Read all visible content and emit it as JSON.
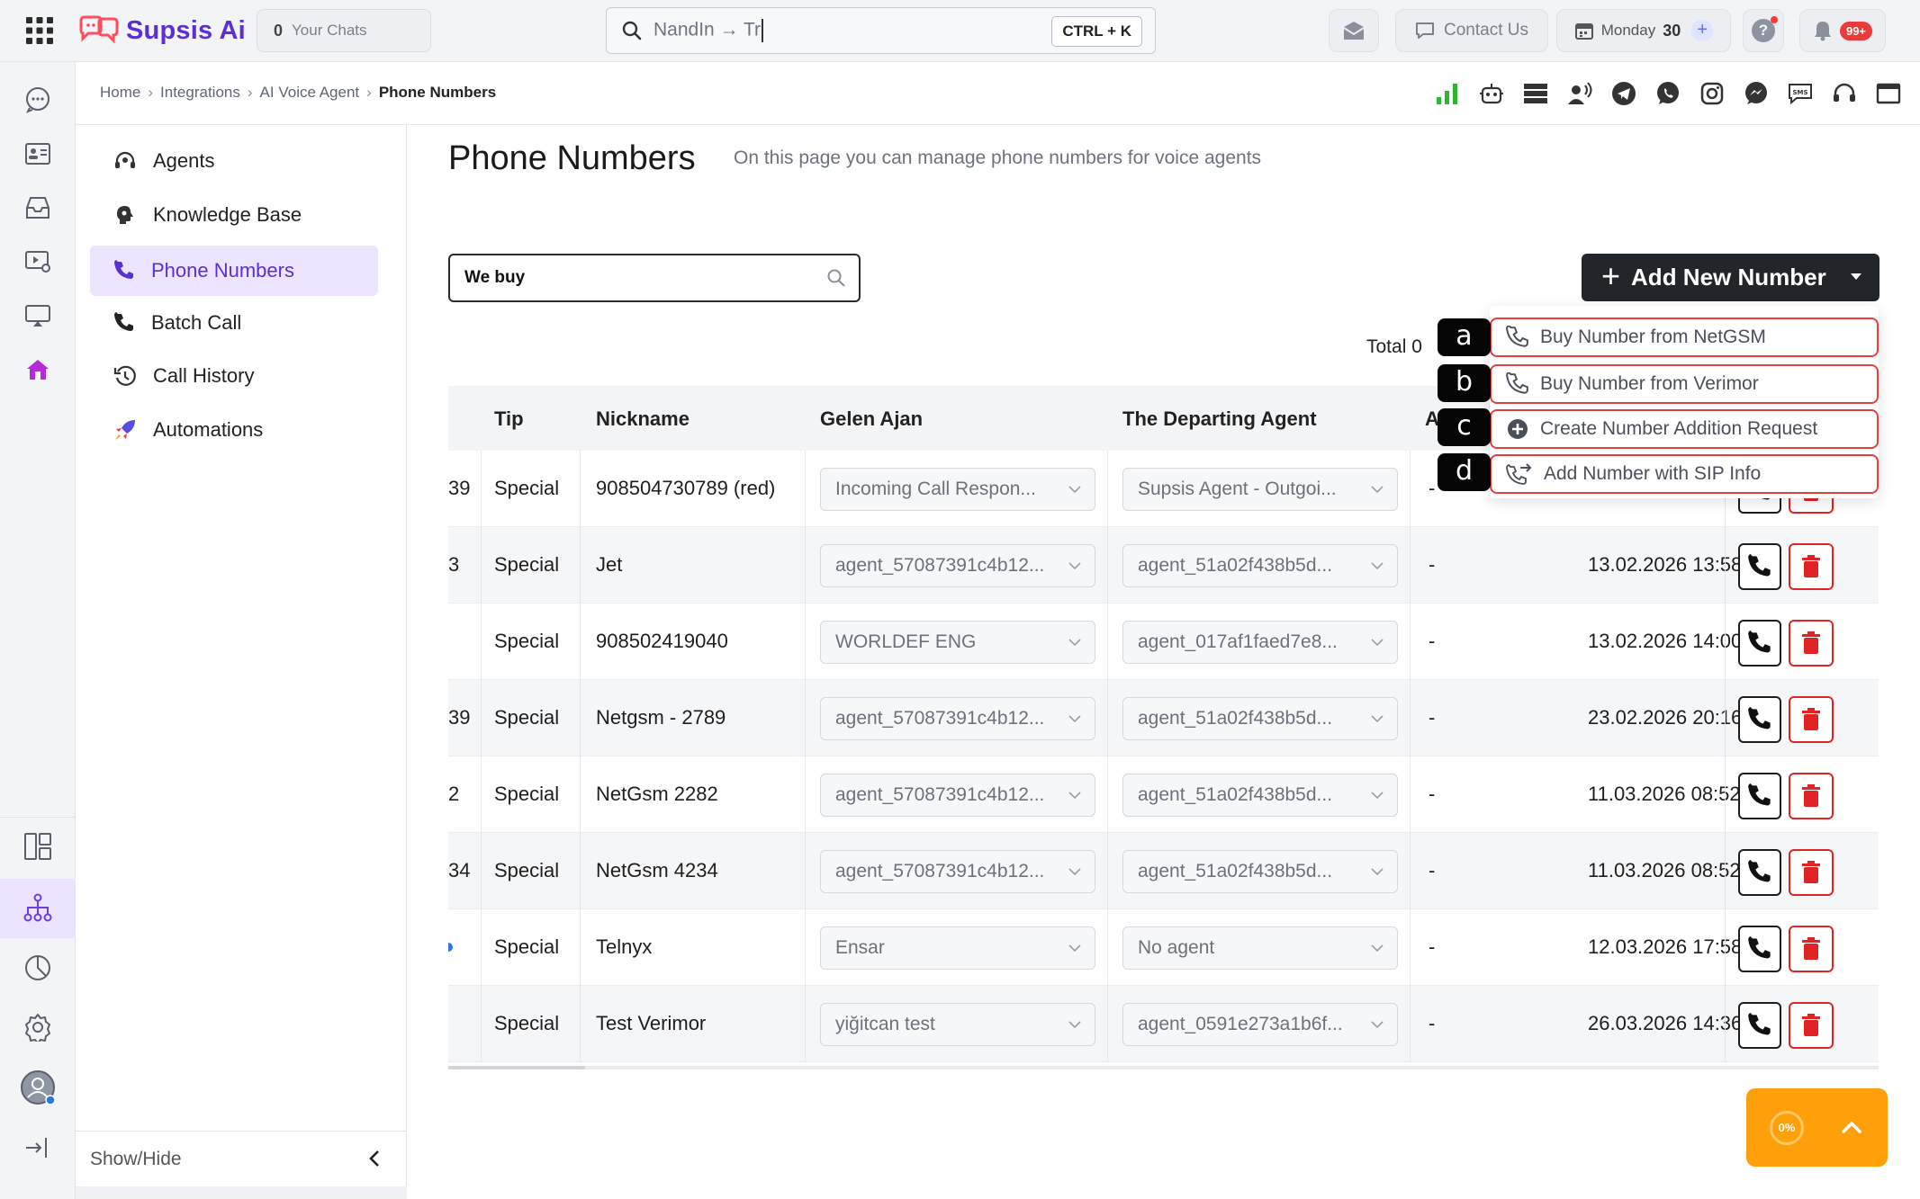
{
  "app": {
    "name": "Supsis Ai",
    "brand_color": "#5b2fd6"
  },
  "topbar": {
    "chats_count": "0",
    "chats_label": "Your Chats",
    "search_value": "NandIn → Tr",
    "search_shortcut": "CTRL + K",
    "contact_label": "Contact Us",
    "date_day": "Monday",
    "date_num": "30",
    "notif_badge": "99+"
  },
  "breadcrumb": {
    "items": [
      "Home",
      "Integrations",
      "AI Voice Agent"
    ],
    "current": "Phone Numbers"
  },
  "subnav": {
    "items": [
      {
        "label": "Agents",
        "icon": "headset-icon"
      },
      {
        "label": "Knowledge Base",
        "icon": "brain-icon"
      },
      {
        "label": "Phone Numbers",
        "icon": "phone-icon"
      },
      {
        "label": "Batch Call",
        "icon": "phone-icon"
      },
      {
        "label": "Call History",
        "icon": "history-icon"
      },
      {
        "label": "Automations",
        "icon": "rocket-icon"
      }
    ],
    "footer_label": "Show/Hide"
  },
  "page": {
    "title": "Phone Numbers",
    "subtitle": "On this page you can manage phone numbers for voice agents",
    "search_value": "We buy",
    "add_button": "Add New Number",
    "total_label": "Total 0"
  },
  "menu": {
    "items": [
      {
        "tag": "a",
        "label": "Buy Number from NetGSM",
        "icon": "phone-icon"
      },
      {
        "tag": "b",
        "label": "Buy Number from Verimor",
        "icon": "phone-icon"
      },
      {
        "tag": "c",
        "label": "Create Number Addition Request",
        "icon": "plus-circle-icon"
      },
      {
        "tag": "d",
        "label": "Add Number with SIP Info",
        "icon": "phone-forward-icon"
      }
    ]
  },
  "table": {
    "headers": {
      "tip": "Tip",
      "nickname": "Nickname",
      "incoming": "Gelen Ajan",
      "departing": "The Departing Agent",
      "partial": "A"
    },
    "rows": [
      {
        "id_tail": "39",
        "tip": "Special",
        "nickname": "908504730789 (red)",
        "incoming": "Incoming Call Respon...",
        "departing": "Supsis Agent - Outgoi...",
        "dash": "-",
        "date": ""
      },
      {
        "id_tail": "3",
        "tip": "Special",
        "nickname": "Jet",
        "incoming": "agent_57087391c4b12...",
        "departing": "agent_51a02f438b5d...",
        "dash": "-",
        "date": "13.02.2026 13:58"
      },
      {
        "id_tail": "",
        "tip": "Special",
        "nickname": "908502419040",
        "incoming": "WORLDEF ENG",
        "departing": "agent_017af1faed7e8...",
        "dash": "-",
        "date": "13.02.2026 14:00"
      },
      {
        "id_tail": "39",
        "tip": "Special",
        "nickname": "Netgsm - 2789",
        "incoming": "agent_57087391c4b12...",
        "departing": "agent_51a02f438b5d...",
        "dash": "-",
        "date": "23.02.2026 20:16"
      },
      {
        "id_tail": "2",
        "tip": "Special",
        "nickname": "NetGsm 2282",
        "incoming": "agent_57087391c4b12...",
        "departing": "agent_51a02f438b5d...",
        "dash": "-",
        "date": "11.03.2026 08:52"
      },
      {
        "id_tail": "34",
        "tip": "Special",
        "nickname": "NetGsm 4234",
        "incoming": "agent_57087391c4b12...",
        "departing": "agent_51a02f438b5d...",
        "dash": "-",
        "date": "11.03.2026 08:52"
      },
      {
        "id_tail": "",
        "tip": "Special",
        "nickname": "Telnyx",
        "incoming": "Ensar",
        "departing": "No agent",
        "dash": "-",
        "date": "12.03.2026 17:58"
      },
      {
        "id_tail": "",
        "tip": "Special",
        "nickname": "Test Verimor",
        "incoming": "yiğitcan test",
        "departing": "agent_0591e273a1b6f...",
        "dash": "-",
        "date": "26.03.2026 14:36"
      }
    ]
  },
  "progress": {
    "percent_label": "0%"
  }
}
